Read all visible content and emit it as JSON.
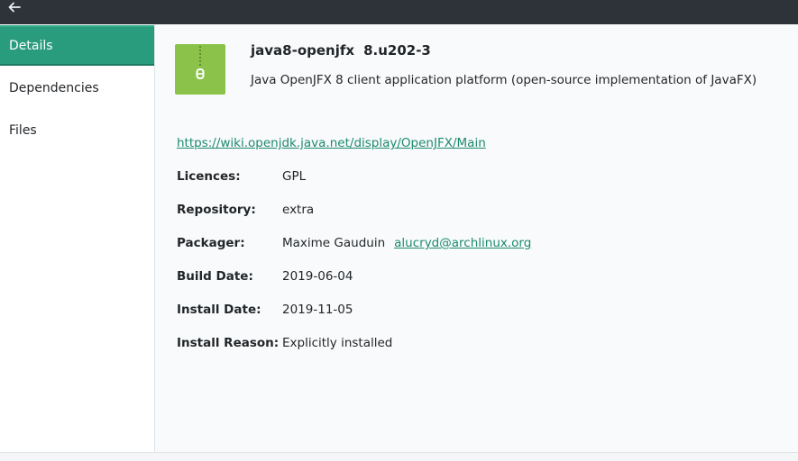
{
  "sidebar": {
    "items": [
      {
        "label": "Details"
      },
      {
        "label": "Dependencies"
      },
      {
        "label": "Files"
      }
    ]
  },
  "package": {
    "name": "java8-openjfx",
    "version": "8.u202-3",
    "description": "Java OpenJFX 8 client application platform (open-source implementation of JavaFX)",
    "url": "https://wiki.openjdk.java.net/display/OpenJFX/Main",
    "icon": "archive-zip-icon"
  },
  "details": {
    "licences": {
      "label": "Licences:",
      "value": "GPL"
    },
    "repository": {
      "label": "Repository:",
      "value": "extra"
    },
    "packager": {
      "label": "Packager:",
      "value": "Maxime Gauduin",
      "email": "alucryd@archlinux.org"
    },
    "build_date": {
      "label": "Build Date:",
      "value": "2019-06-04"
    },
    "install_date": {
      "label": "Install Date:",
      "value": "2019-11-05"
    },
    "install_reason": {
      "label": "Install Reason:",
      "value": "Explicitly installed"
    }
  },
  "colors": {
    "accent": "#2a9c7e",
    "link": "#1d8a6e",
    "icon_bg": "#8bc34a",
    "topbar": "#2d3338"
  }
}
